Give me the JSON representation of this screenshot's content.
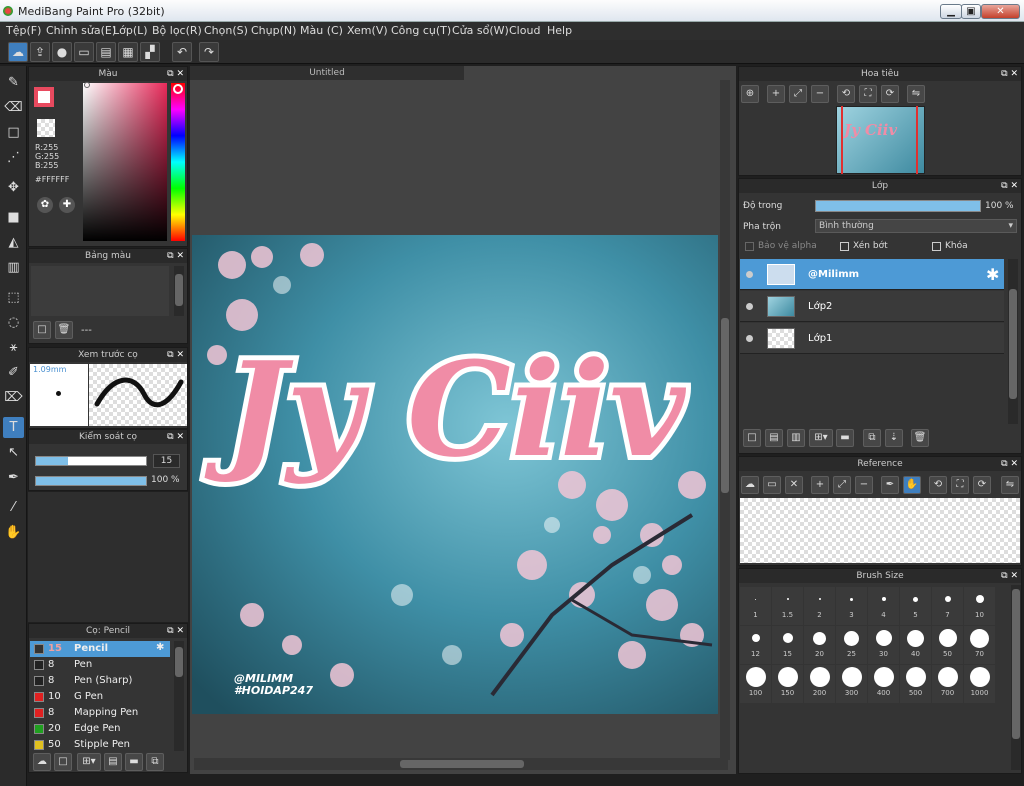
{
  "window": {
    "title": "MediBang Paint Pro (32bit)"
  },
  "menu": [
    "Tệp(F)",
    "Chỉnh sửa(E)",
    "Lớp(L)",
    "Bộ lọc(R)",
    "Chọn(S)",
    "Chụp(N)",
    "Màu (C)",
    "Xem(V)",
    "Công cụ(T)",
    "Cửa sổ(W)",
    "Cloud",
    "Help"
  ],
  "color_panel": {
    "title": "Màu",
    "r": "R:255",
    "g": "G:255",
    "b": "B:255",
    "hex": "#FFFFFF"
  },
  "palette_panel": {
    "title": "Bảng màu",
    "name": "---"
  },
  "brush_preview": {
    "title": "Xem trước cọ",
    "size": "1.09mm"
  },
  "brush_control": {
    "title": "Kiểm soát cọ",
    "size_value": "15",
    "opacity_value": "100 %",
    "size_fraction": 0.29,
    "opacity_fraction": 1.0
  },
  "brush_panel": {
    "title": "Cọ: Pencil",
    "items": [
      {
        "size": "15",
        "name": "Pencil",
        "color": "#333333",
        "selected": true
      },
      {
        "size": "8",
        "name": "Pen",
        "color": "#222222"
      },
      {
        "size": "8",
        "name": "Pen (Sharp)",
        "color": "#222222"
      },
      {
        "size": "10",
        "name": "G Pen",
        "color": "#e02020"
      },
      {
        "size": "8",
        "name": "Mapping Pen",
        "color": "#e02020"
      },
      {
        "size": "20",
        "name": "Edge Pen",
        "color": "#20a020"
      },
      {
        "size": "50",
        "name": "Stipple Pen",
        "color": "#e0c020"
      }
    ]
  },
  "canvas": {
    "tab": "Untitled",
    "artwork_text": "Jy Ciiv",
    "watermark_1": "@MILIMM",
    "watermark_2": "#HOIDAP247"
  },
  "navigator": {
    "title": "Hoa tiêu"
  },
  "layers": {
    "title": "Lớp",
    "opacity_label": "Độ trong",
    "opacity_value": "100 %",
    "opacity_fraction": 1.0,
    "blend_label": "Pha trộn",
    "blend_value": "Bình thường",
    "protect_alpha": "Bảo vệ alpha",
    "clipping": "Xén bớt",
    "lock": "Khóa",
    "items": [
      {
        "name": "@Milimm",
        "selected": true
      },
      {
        "name": "Lớp2"
      },
      {
        "name": "Lớp1"
      }
    ]
  },
  "reference": {
    "title": "Reference"
  },
  "brush_size": {
    "title": "Brush Size",
    "sizes": [
      "1",
      "1.5",
      "2",
      "3",
      "4",
      "5",
      "7",
      "10",
      "12",
      "15",
      "20",
      "25",
      "30",
      "40",
      "50",
      "70",
      "100",
      "150",
      "200",
      "300",
      "400",
      "500",
      "700",
      "1000"
    ]
  }
}
